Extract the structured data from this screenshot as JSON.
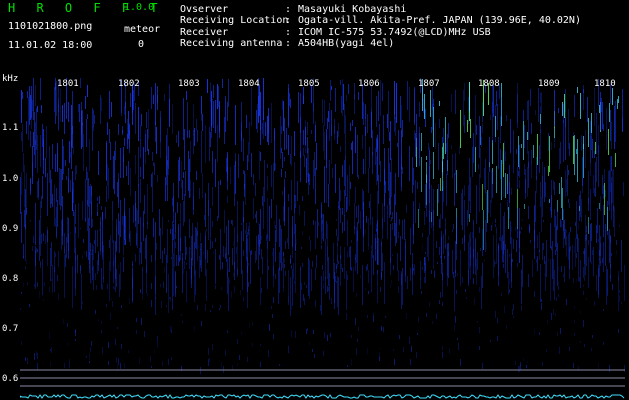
{
  "header": {
    "app_title": "H R O F F T",
    "version": "1.0.0",
    "file_name": "1101021800.png",
    "meteor_label": "meteor",
    "meteor_count": "0",
    "datetime": "11.01.02 18:00",
    "fields": [
      {
        "key": "Ovserver",
        "value": "Masayuki Kobayashi"
      },
      {
        "key": "Receiving Location",
        "value": "Ogata-vill. Akita-Pref. JAPAN (139.96E, 40.02N)"
      },
      {
        "key": "Receiver",
        "value": "ICOM IC-575 53.7492(@LCD)MHz USB"
      },
      {
        "key": "Receiving antenna",
        "value": "A504HB(yagi 4el)"
      }
    ]
  },
  "axis": {
    "y_unit": "kHz",
    "y_ticks": [
      "1.1",
      "1.0",
      "0.9",
      "0.8",
      "0.7",
      "0.6"
    ],
    "x_ticks": [
      "1801",
      "1802",
      "1803",
      "1804",
      "1805",
      "1806",
      "1807",
      "1808",
      "1809",
      "1810"
    ]
  },
  "colors": {
    "background": "#000000",
    "title_green": "#00e000",
    "noise_blue": "#1a3cff",
    "noise_cyan": "#40e0ff",
    "noise_green": "#60ff60"
  }
}
